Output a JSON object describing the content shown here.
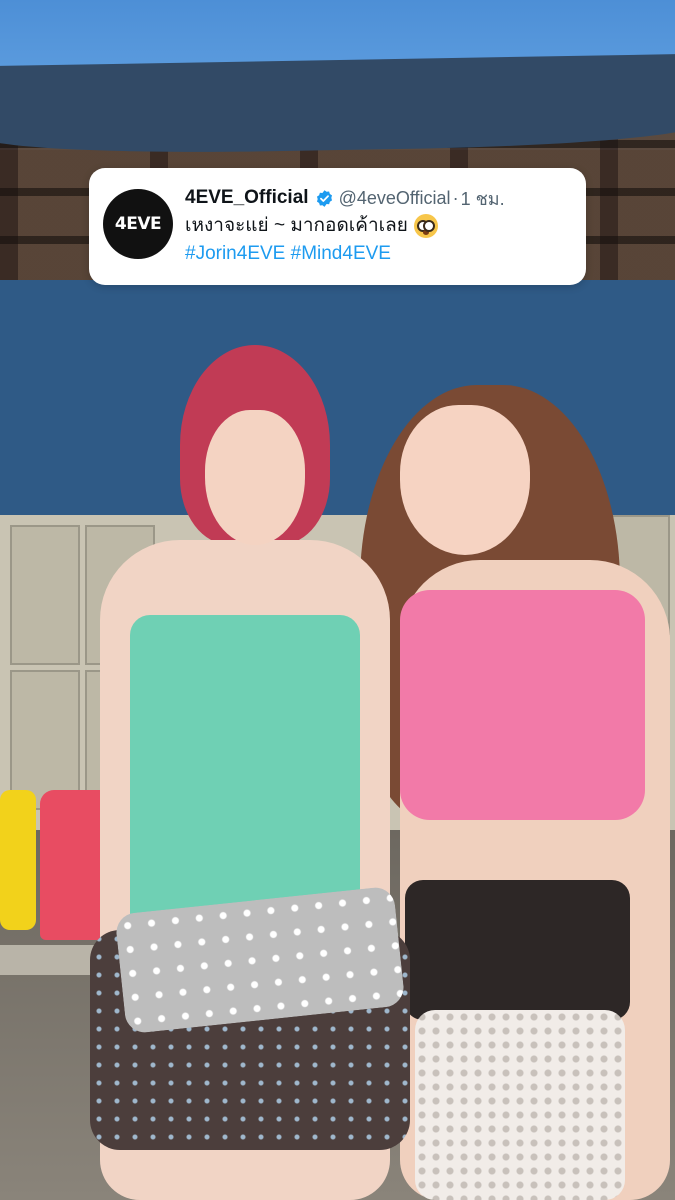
{
  "tweet": {
    "avatar_text": "4EVE",
    "display_name": "4EVE_Official",
    "handle": "@4eveOfficial",
    "separator": "·",
    "timestamp": "1 ชม.",
    "text": "เหงาจะแย่ ~ มากอดเค้าเลย",
    "emoji": "flushed-face-emoji",
    "hashtags": [
      "#Jorin4EVE",
      "#Mind4EVE"
    ],
    "verified_color": "#1d9bf0",
    "hashtag_color": "#1d9bf0"
  }
}
